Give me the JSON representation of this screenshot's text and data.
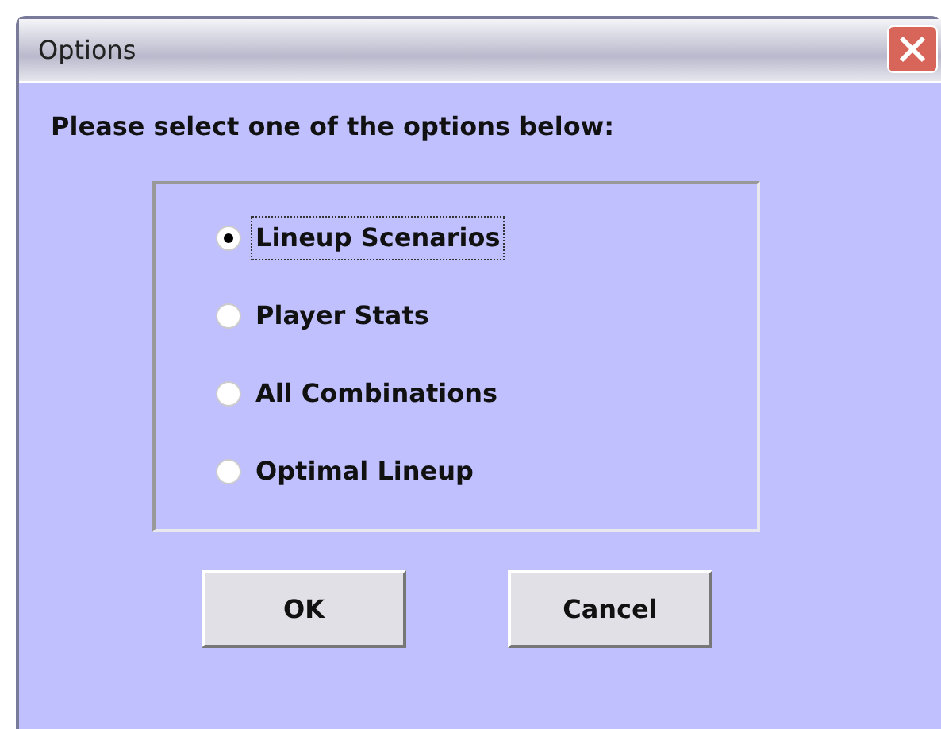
{
  "window": {
    "title": "Options"
  },
  "prompt": "Please select one of the options below:",
  "options": [
    {
      "label": "Lineup Scenarios",
      "selected": true,
      "focused": true
    },
    {
      "label": "Player Stats",
      "selected": false,
      "focused": false
    },
    {
      "label": "All Combinations",
      "selected": false,
      "focused": false
    },
    {
      "label": "Optimal Lineup",
      "selected": false,
      "focused": false
    }
  ],
  "buttons": [
    "OK",
    "Cancel"
  ]
}
